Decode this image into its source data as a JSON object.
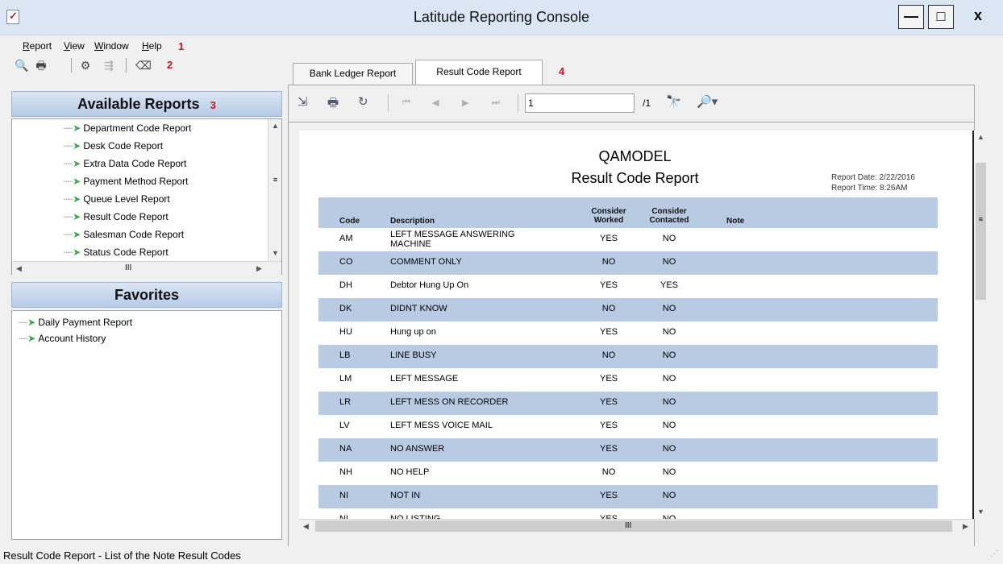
{
  "window": {
    "title": "Latitude Reporting Console",
    "minimize": "—",
    "maximize": "□",
    "close": "x"
  },
  "menu": {
    "items": [
      "Report",
      "View",
      "Window",
      "Help"
    ],
    "callout": "1"
  },
  "toolbar": {
    "callout": "2",
    "icons": [
      "print-preview-icon",
      "print-icon",
      "report-properties-icon",
      "export-icon",
      "eraser-icon"
    ]
  },
  "available_reports": {
    "title": "Available Reports",
    "callout": "3",
    "items": [
      "Department Code Report",
      "Desk Code Report",
      "Extra Data Code Report",
      "Payment Method Report",
      "Queue Level Report",
      "Result Code Report",
      "Salesman Code Report",
      "Status Code Report"
    ],
    "hscroll_thumb": "III"
  },
  "favorites": {
    "title": "Favorites",
    "items": [
      "Daily Payment Report",
      "Account History"
    ]
  },
  "tabs": {
    "items": [
      "Bank Ledger Report",
      "Result Code Report"
    ],
    "active_index": 1,
    "callout": "4"
  },
  "viewer": {
    "page_value": "1",
    "page_total": "/1"
  },
  "report": {
    "org": "QAMODEL",
    "title": "Result Code Report",
    "date_label": "Report Date:",
    "date_value": "2/22/2016",
    "time_label": "Report Time:",
    "time_value": "8:26AM",
    "headers": {
      "code": "Code",
      "description": "Description",
      "worked": "Consider Worked",
      "worked_l1": "Consider",
      "worked_l2": "Worked",
      "contacted_l1": "Consider",
      "contacted_l2": "Contacted",
      "note": "Note"
    },
    "rows": [
      {
        "code": "AM",
        "description": "LEFT MESSAGE ANSWERING MACHINE",
        "worked": "YES",
        "contacted": "NO"
      },
      {
        "code": "CO",
        "description": "COMMENT ONLY",
        "worked": "NO",
        "contacted": "NO"
      },
      {
        "code": "DH",
        "description": "Debtor Hung Up On",
        "worked": "YES",
        "contacted": "YES"
      },
      {
        "code": "DK",
        "description": "DIDNT KNOW",
        "worked": "NO",
        "contacted": "NO"
      },
      {
        "code": "HU",
        "description": "Hung up on",
        "worked": "YES",
        "contacted": "NO"
      },
      {
        "code": "LB",
        "description": "LINE BUSY",
        "worked": "NO",
        "contacted": "NO"
      },
      {
        "code": "LM",
        "description": "LEFT MESSAGE",
        "worked": "YES",
        "contacted": "NO"
      },
      {
        "code": "LR",
        "description": "LEFT MESS ON RECORDER",
        "worked": "YES",
        "contacted": "NO"
      },
      {
        "code": "LV",
        "description": "LEFT MESS VOICE MAIL",
        "worked": "YES",
        "contacted": "NO"
      },
      {
        "code": "NA",
        "description": "NO ANSWER",
        "worked": "YES",
        "contacted": "NO"
      },
      {
        "code": "NH",
        "description": "NO HELP",
        "worked": "NO",
        "contacted": "NO"
      },
      {
        "code": "NI",
        "description": "NOT IN",
        "worked": "YES",
        "contacted": "NO"
      },
      {
        "code": "NL",
        "description": "NO LISTING",
        "worked": "YES",
        "contacted": "NO"
      }
    ],
    "hscroll_thumb": "III"
  },
  "status": {
    "text": "Result Code Report - List of the Note Result Codes"
  },
  "colors": {
    "accent_header": "#b9cbe3",
    "callout": "#d0101c",
    "tree_icon": "#38a84a"
  }
}
